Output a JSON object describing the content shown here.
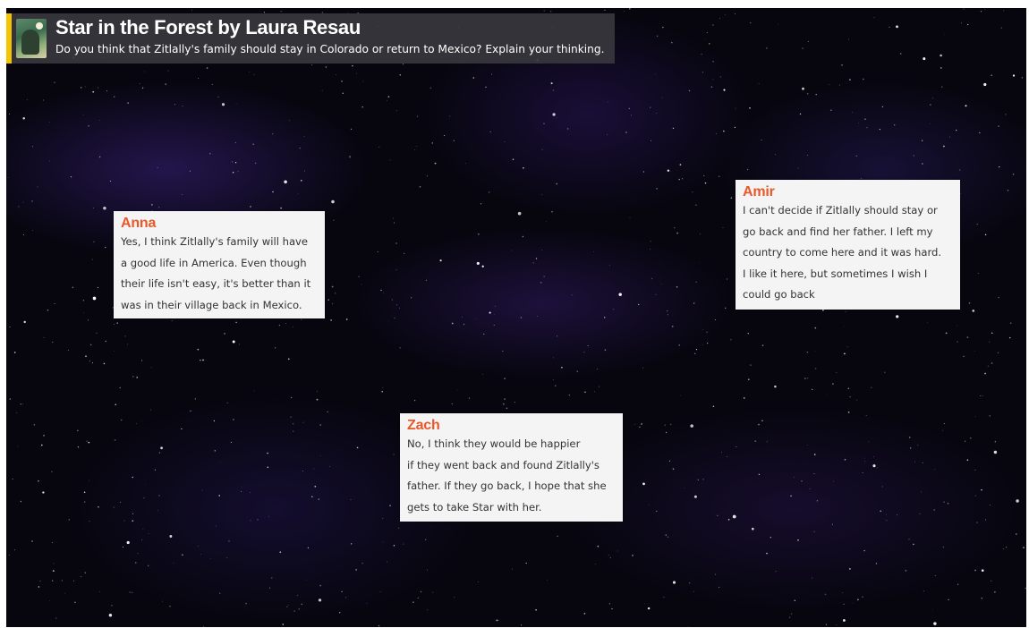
{
  "header": {
    "title": "Star in the Forest by Laura Resau",
    "subtitle": "Do you think that Zitlally's family should stay in Colorado or return to Mexico? Explain your thinking.",
    "accent_color": "#f5c400",
    "thumbnail_icon": "book-cover-thumbnail"
  },
  "notes": [
    {
      "author": "Anna",
      "text": "Yes, I think Zitlally's family will have\na good life in America. Even though\ntheir life isn't easy, it's better than it\nwas in their village back in Mexico."
    },
    {
      "author": "Amir",
      "text": "I can't decide if Zitlally should stay or\ngo back and find her father. I left my\ncountry to come here and it was hard.\nI like it here, but sometimes I wish I\ncould go back"
    },
    {
      "author": "Zach",
      "text": "No, I think they would be happier\nif they went back and found Zitlally's\nfather. If they go back, I hope that she\ngets to take Star with her."
    }
  ],
  "colors": {
    "author_name": "#e9582a",
    "note_background": "#f4f4f4",
    "header_background": "#37373c",
    "board_background": "#07060f"
  }
}
